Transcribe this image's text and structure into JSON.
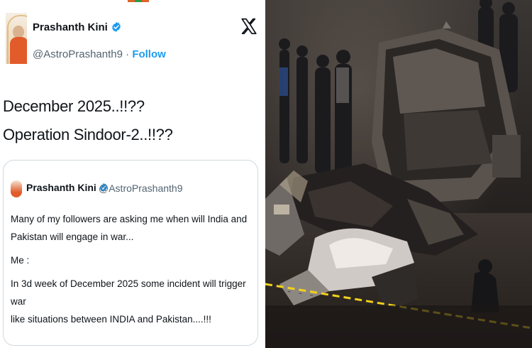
{
  "tweet": {
    "display_name": "Prashanth Kini",
    "handle": "@AstroPrashanth9",
    "separator": "·",
    "follow_label": "Follow",
    "text_line1": "December 2025..!!??",
    "text_line2": "Operation Sindoor-2..!!??"
  },
  "quote": {
    "display_name": "Prashanth Kini",
    "handle": "@AstroPrashanth9",
    "paragraph1_line1": "Many of my followers are asking me when will India and",
    "paragraph1_line2": "Pakistan will engage in war...",
    "paragraph2": "Me :",
    "paragraph3_line1": "In 3d week of December 2025 some incident will trigger war",
    "paragraph3_line2": "like situations between INDIA and Pakistan....!!!"
  },
  "colors": {
    "verified_blue": "#1d9bf0",
    "text_primary": "#0f1419",
    "text_secondary": "#536471",
    "border": "#cfd9de"
  },
  "icons": {
    "verified": "verified-badge-icon",
    "x_logo": "x-logo-icon"
  }
}
